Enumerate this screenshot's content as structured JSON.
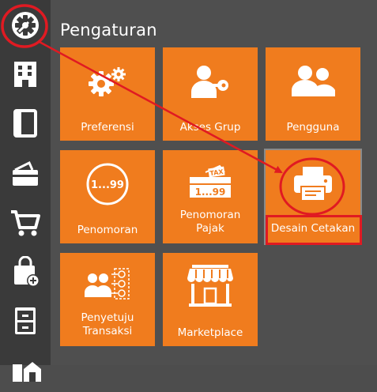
{
  "header": {
    "title": "Pengaturan"
  },
  "sidebar": {
    "items": [
      {
        "icon": "gear-icon"
      },
      {
        "icon": "building-icon"
      },
      {
        "icon": "book-icon"
      },
      {
        "icon": "wallet-icon"
      },
      {
        "icon": "cart-icon"
      },
      {
        "icon": "shopping-bag-add-icon"
      },
      {
        "icon": "cabinet-icon"
      },
      {
        "icon": "warehouse-icon"
      }
    ]
  },
  "tiles": [
    {
      "id": "preferensi",
      "label": "Preferensi",
      "icon": "gears-icon"
    },
    {
      "id": "akses-grup",
      "label": "Akses Grup",
      "icon": "user-key-icon"
    },
    {
      "id": "pengguna",
      "label": "Pengguna",
      "icon": "users-icon"
    },
    {
      "id": "penomoran",
      "label": "Penomoran",
      "icon": "numbering-icon",
      "icon_text": "1...99"
    },
    {
      "id": "penomoran-pajak",
      "label_line1": "Penomoran",
      "label_line2": "Pajak",
      "icon": "tax-numbering-icon",
      "icon_text": "1...99",
      "icon_tag": "TAX"
    },
    {
      "id": "desain-cetakan",
      "label": "Desain Cetakan",
      "icon": "printer-icon"
    },
    {
      "id": "penyetuju-transaksi",
      "label_line1": "Penyetuju",
      "label_line2": "Transaksi",
      "icon": "approver-icon"
    },
    {
      "id": "marketplace",
      "label": "Marketplace",
      "icon": "storefront-icon"
    }
  ],
  "colors": {
    "tile": "#f07c1e",
    "sidebar": "#3a3a3a",
    "background": "#4f4f4f",
    "annotation": "#e01a22"
  }
}
